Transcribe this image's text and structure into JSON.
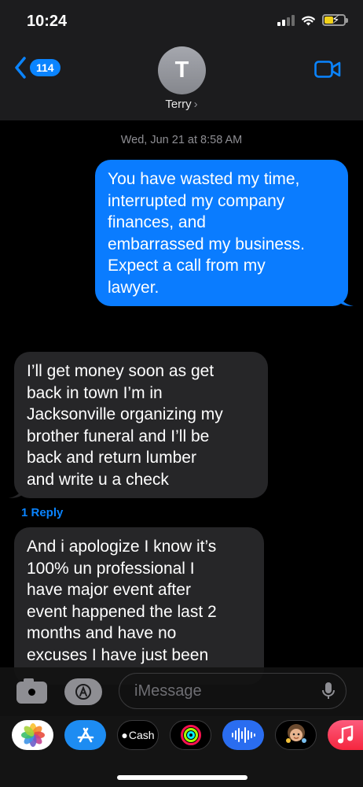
{
  "status_bar": {
    "time": "10:24"
  },
  "nav": {
    "back_count": "114",
    "contact_initial": "T",
    "contact_name": "Terry",
    "chevron": "›"
  },
  "conversation": {
    "timestamp": "Wed, Jun 21 at 8:58 AM",
    "messages": [
      {
        "direction": "outgoing",
        "lines": [
          "You have wasted my time,",
          "interrupted my company",
          "finances, and",
          "embarrassed my business.",
          "Expect a call from my",
          "lawyer."
        ]
      },
      {
        "direction": "incoming",
        "lines": [
          "I’ll get money soon as get",
          "back in town I’m in",
          "Jacksonville organizing my",
          "brother funeral and I’ll be",
          "back and return lumber",
          "and write u a check"
        ]
      },
      {
        "direction": "incoming",
        "lines": [
          "And i apologize I know it’s",
          "100% un professional I",
          "have major event after",
          "event happened the last 2",
          "months and have no",
          "excuses I have just been"
        ]
      }
    ],
    "reply_link": "1 Reply"
  },
  "composer": {
    "placeholder": "iMessage"
  },
  "app_strip": {
    "items": [
      "photos-icon",
      "app-store-icon",
      "apple-cash-icon",
      "activity-icon",
      "audio-message-icon",
      "memoji-icon",
      "music-icon"
    ],
    "cash_label": "Cash"
  },
  "colors": {
    "outgoing_bubble": "#0a7cff",
    "incoming_bubble": "#262628",
    "accent": "#0a84ff"
  }
}
